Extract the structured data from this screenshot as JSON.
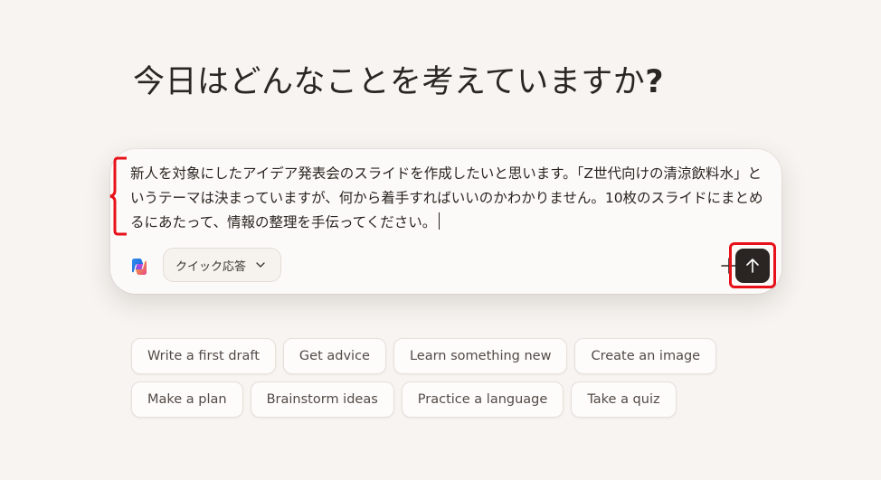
{
  "heading": {
    "text": "今日はどんなことを考えていますか",
    "question_mark": "?"
  },
  "composer": {
    "prompt_text": "新人を対象にしたアイデア発表会のスライドを作成したいと思います。「Z世代向けの清涼飲料水」というテーマは決まっていますが、何から着手すればいいのかわかりません。10枚のスライドにまとめるにあたって、情報の整理を手伝ってください。",
    "mode_label": "クイック応答",
    "mode_icon": "chevron-down-icon",
    "plus_icon": "plus-icon",
    "send_icon": "arrow-up-icon",
    "highlight_color": "#e8111a"
  },
  "suggestions": {
    "row1": [
      "Write a first draft",
      "Get advice",
      "Learn something new",
      "Create an image"
    ],
    "row2": [
      "Make a plan",
      "Brainstorm ideas",
      "Practice a language",
      "Take a quiz"
    ]
  }
}
